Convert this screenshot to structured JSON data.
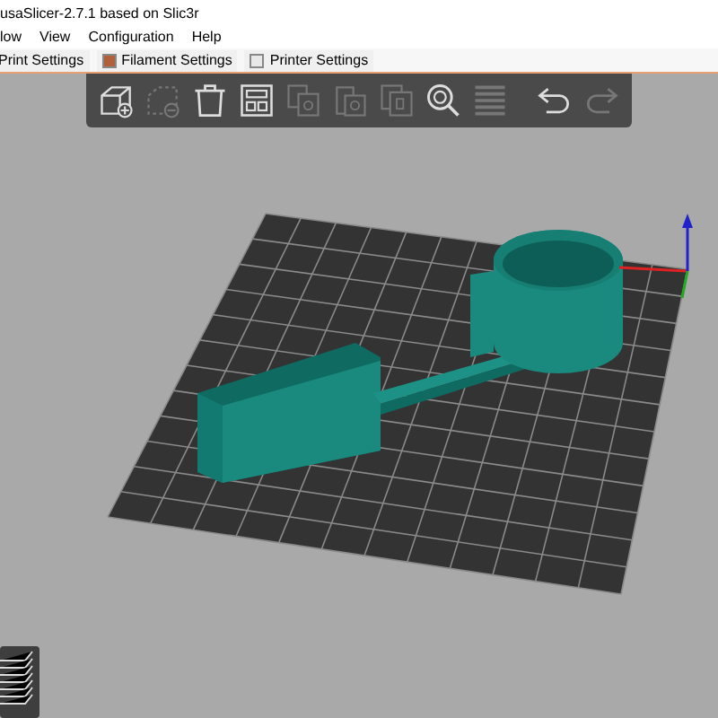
{
  "window": {
    "title": "usaSlicer-2.7.1 based on Slic3r"
  },
  "menu": [
    "low",
    "View",
    "Configuration",
    "Help"
  ],
  "tabs": [
    {
      "label": "Print Settings",
      "kind": "print",
      "selected": false
    },
    {
      "label": "Filament Settings",
      "kind": "filament",
      "selected": false
    },
    {
      "label": "Printer Settings",
      "kind": "printer",
      "selected": false
    }
  ],
  "toolbar": [
    {
      "kind": "add",
      "disabled": false
    },
    {
      "kind": "remove",
      "disabled": true
    },
    {
      "kind": "delete_all",
      "disabled": false
    },
    {
      "kind": "arrange",
      "disabled": false
    },
    {
      "kind": "copy",
      "disabled": true
    },
    {
      "kind": "paste",
      "disabled": true
    },
    {
      "kind": "instance",
      "disabled": true
    },
    {
      "kind": "search",
      "disabled": false
    },
    {
      "kind": "layers",
      "disabled": true
    },
    {
      "kind": "undo",
      "disabled": false
    },
    {
      "kind": "redo",
      "disabled": true
    }
  ]
}
